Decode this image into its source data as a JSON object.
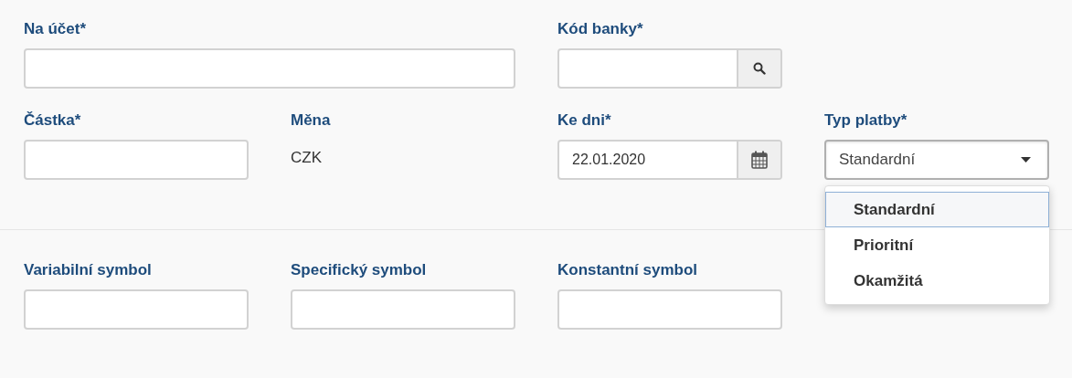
{
  "sections": [
    {
      "rows": [
        {
          "fields": [
            {
              "kind": "account",
              "label": "Na účet*"
            },
            {
              "kind": "lookup",
              "label": "Kód banky*"
            }
          ]
        },
        {
          "fields": [
            {
              "kind": "text",
              "label": "Částka*"
            },
            {
              "kind": "static",
              "label": "Měna",
              "value": "CZK"
            },
            {
              "kind": "date",
              "label": "Ke dni*",
              "value": "22.01.2020"
            },
            {
              "kind": "select",
              "label": "Typ platby*",
              "value": "Standardní",
              "expanded": true,
              "options": [
                {
                  "label": "Standardní",
                  "selected": true
                },
                {
                  "label": "Prioritní",
                  "selected": false
                },
                {
                  "label": "Okamžitá",
                  "selected": false
                }
              ]
            }
          ]
        }
      ]
    },
    {
      "rows": [
        {
          "fields": [
            {
              "kind": "text",
              "label": "Variabilní symbol"
            },
            {
              "kind": "text",
              "label": "Specifický symbol"
            },
            {
              "kind": "text",
              "label": "Konstantní symbol"
            }
          ]
        }
      ]
    }
  ]
}
